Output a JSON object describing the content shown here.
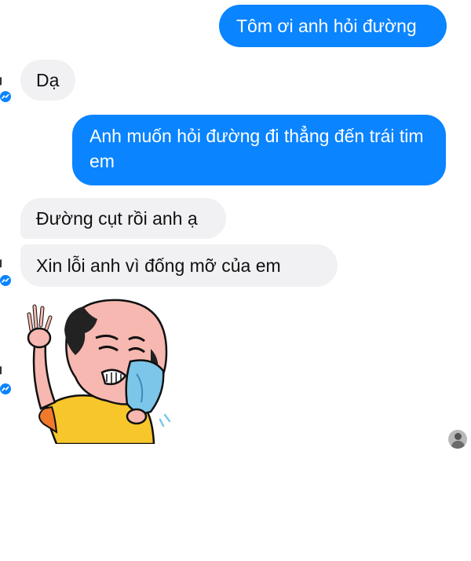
{
  "messages": [
    {
      "side": "outgoing",
      "text": "Tôm ơi anh hỏi đường"
    },
    {
      "side": "incoming",
      "text": "Dạ"
    },
    {
      "side": "outgoing",
      "text": "Anh muốn hỏi đường đi thẳng đến trái tim em"
    },
    {
      "side": "incoming",
      "text": "Đường cụt rồi anh ạ"
    },
    {
      "side": "incoming",
      "text": "Xin lỗi anh vì đống mỡ    của em"
    }
  ],
  "sticker": {
    "icon": "crying-bald-man-sticker"
  },
  "colors": {
    "outgoing_bubble": "#0a84ff",
    "incoming_bubble": "#f1f1f3",
    "background": "#ffffff"
  },
  "icons": {
    "messenger_badge": "messenger-icon",
    "seen_avatar": "avatar-icon"
  }
}
